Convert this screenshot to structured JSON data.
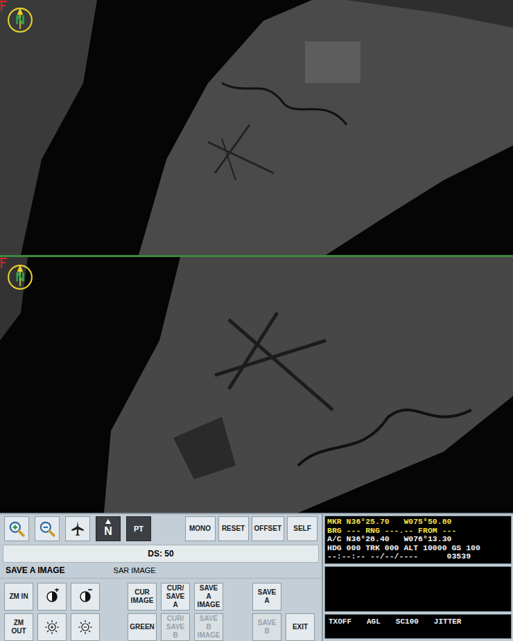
{
  "sar_views": [
    {
      "name": "upper",
      "compass": "N"
    },
    {
      "name": "lower",
      "compass": "N"
    }
  ],
  "toolbar": {
    "icon_buttons": [
      {
        "kind": "zoom-in",
        "label": "",
        "selected": false
      },
      {
        "kind": "zoom-out",
        "label": "",
        "selected": false
      },
      {
        "kind": "track-up",
        "label": "",
        "selected": false
      },
      {
        "kind": "north-up",
        "label": "N",
        "selected": true
      },
      {
        "kind": "text",
        "label": "PT",
        "selected": true
      }
    ],
    "buttons": [
      "MONO",
      "RESET",
      "OFFSET",
      "SELF"
    ]
  },
  "ds": "DS: 50",
  "status": {
    "mode": "SAVE A IMAGE",
    "view": "SAR IMAGE"
  },
  "control_rows": [
    {
      "left": [
        {
          "kind": "text",
          "label": "ZM IN",
          "disabled": false
        },
        {
          "kind": "contrast-up",
          "label": "",
          "disabled": false
        },
        {
          "kind": "contrast-down",
          "label": "",
          "disabled": false
        }
      ],
      "middle": [
        {
          "kind": "text",
          "label": "CUR IMAGE",
          "disabled": false
        },
        {
          "kind": "text",
          "label": "CUR/ SAVE A",
          "disabled": false
        },
        {
          "kind": "text",
          "label": "SAVE A IMAGE",
          "disabled": false
        }
      ],
      "right": [
        {
          "kind": "text",
          "label": "SAVE A",
          "disabled": false
        }
      ]
    },
    {
      "left": [
        {
          "kind": "text",
          "label": "ZM OUT",
          "disabled": false
        },
        {
          "kind": "brightness-up",
          "label": "",
          "disabled": false
        },
        {
          "kind": "brightness-down",
          "label": "",
          "disabled": false
        }
      ],
      "middle": [
        {
          "kind": "text",
          "label": "GREEN",
          "disabled": false
        },
        {
          "kind": "text",
          "label": "CUR/ SAVE B",
          "disabled": true
        },
        {
          "kind": "text",
          "label": "SAVE B IMAGE",
          "disabled": true
        }
      ],
      "right": [
        {
          "kind": "text",
          "label": "SAVE B",
          "disabled": true
        },
        {
          "kind": "text",
          "label": "EXIT",
          "disabled": false
        }
      ]
    }
  ],
  "nav_display": {
    "lines": [
      {
        "text": "MKR N36°25.70   W075°50.80",
        "color": "#f4e04a"
      },
      {
        "text": "BRG --- RNG ---.-- FROM ---",
        "color": "#f4e04a"
      },
      {
        "text": "A/C N36°28.40   W076°13.30",
        "color": "#f2f2f2"
      },
      {
        "text": "HDG 000 TRK 000 ALT 10000 GS 100",
        "color": "#f2f2f2"
      },
      {
        "text": "--:--:-- --/--/----      03539",
        "color": "#f2f2f2"
      }
    ],
    "message": "",
    "flags": [
      "TXOFF",
      "AGL",
      "SC100",
      "JITTER"
    ]
  }
}
